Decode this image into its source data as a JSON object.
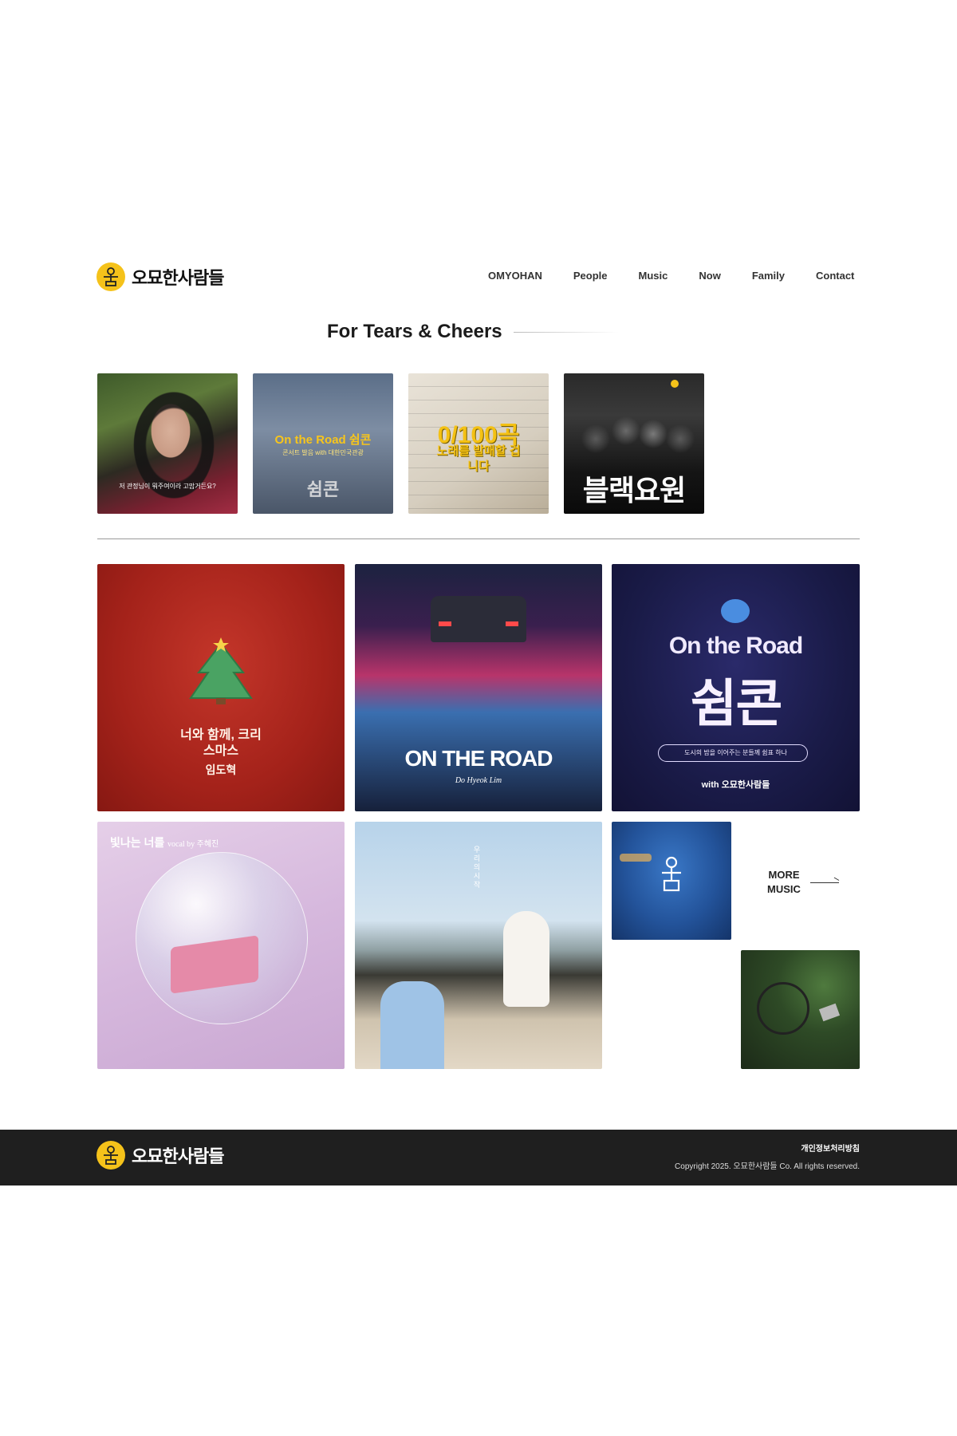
{
  "brand": {
    "name": "오묘한사람들",
    "logo_icon": "person-circle-icon",
    "accent": "#f5c21a"
  },
  "nav": {
    "items": [
      "OMYOHAN",
      "People",
      "Music",
      "Now",
      "Family",
      "Contact"
    ]
  },
  "section": {
    "title": "For Tears & Cheers"
  },
  "thumbnails": [
    {
      "caption": "저 관정님이 뭐주여이라 고맙거든요?"
    },
    {
      "headline": "On the Road 쉼콘",
      "subline": "콘서트 발음 with 대한민국관광",
      "big": "쉼콘"
    },
    {
      "headline": "0/100곡",
      "subline": "노래를 발매할 겁니다"
    },
    {
      "headline": "블랙요원"
    }
  ],
  "albums": [
    {
      "title": "너와 함께, 크리스마스",
      "artist": "임도혁"
    },
    {
      "title": "ON THE ROAD",
      "artist": "Do Hyeok Lim"
    },
    {
      "title": "On the Road",
      "big": "쉼콘",
      "tag": "도시의 밤을 이어주는 분들께 쉼표 하나",
      "with": "with 오묘한사람들"
    },
    {
      "title": "빛나는 너를",
      "vocal": "vocal by 주혜진"
    },
    {
      "title": "우리의 시작"
    },
    {
      "title": ""
    },
    {
      "title": ""
    }
  ],
  "more_music": {
    "label": "MORE\nMUSIC"
  },
  "footer": {
    "privacy": "개인정보처리방침",
    "copyright": "Copyright 2025. 오묘한사람들 Co. All rights reserved."
  }
}
